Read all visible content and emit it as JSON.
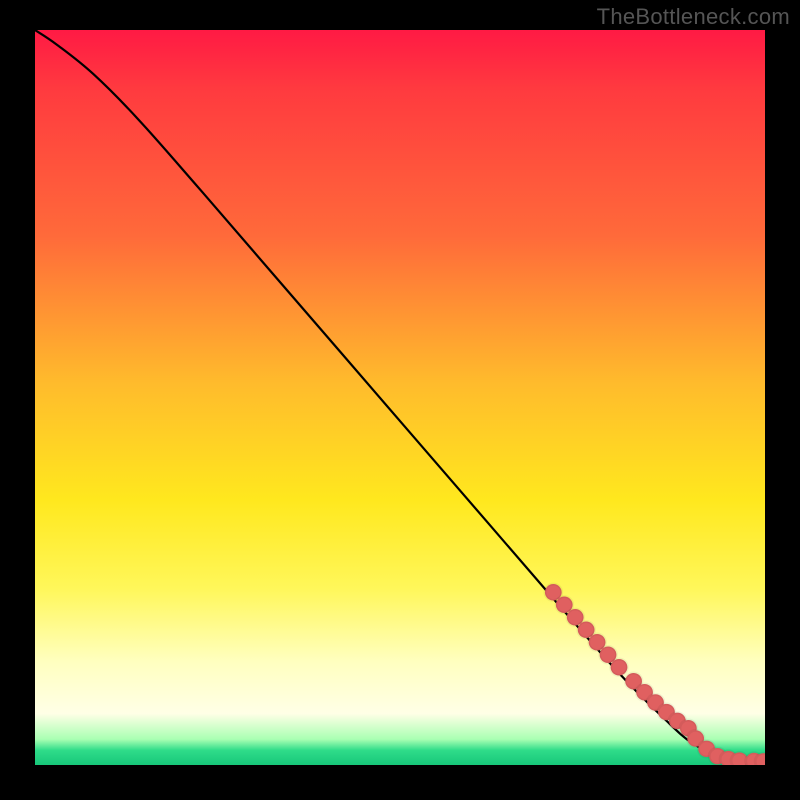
{
  "watermark": "TheBottleneck.com",
  "colors": {
    "frame_background": "#000000",
    "watermark_text": "#555555",
    "curve": "#000000",
    "marker": "#e06060",
    "gradient_stops": [
      "#ff1a44",
      "#ff6a3a",
      "#ffe81e",
      "#ffffe6",
      "#2fdc89"
    ]
  },
  "chart_data": {
    "type": "line",
    "title": "",
    "xlabel": "",
    "ylabel": "",
    "xlim": [
      0,
      100
    ],
    "ylim": [
      0,
      100
    ],
    "note": "Axes are unlabeled in the source image; values below are normalized percentages of the visible plot box (0 = left/bottom, 100 = right/top).",
    "series": [
      {
        "name": "curve",
        "kind": "line",
        "x": [
          0,
          3,
          8,
          14,
          22,
          32,
          42,
          52,
          62,
          72,
          80,
          86,
          90,
          94,
          97,
          100
        ],
        "y": [
          100,
          98,
          94,
          88,
          79,
          67.5,
          56,
          44.5,
          33,
          21.5,
          12.5,
          6.5,
          3,
          1.2,
          0.6,
          0.5
        ]
      },
      {
        "name": "markers",
        "kind": "scatter",
        "x": [
          71,
          72.5,
          74,
          75.5,
          77,
          78.5,
          80,
          82,
          83.5,
          85,
          86.5,
          88,
          89.5,
          90.5,
          92,
          93.5,
          95,
          96.5,
          98.5,
          99.8
        ],
        "y": [
          23.5,
          21.8,
          20.1,
          18.4,
          16.7,
          15,
          13.3,
          11.4,
          9.9,
          8.5,
          7.2,
          6,
          5,
          3.6,
          2.2,
          1.2,
          0.8,
          0.6,
          0.55,
          0.5
        ]
      }
    ]
  }
}
